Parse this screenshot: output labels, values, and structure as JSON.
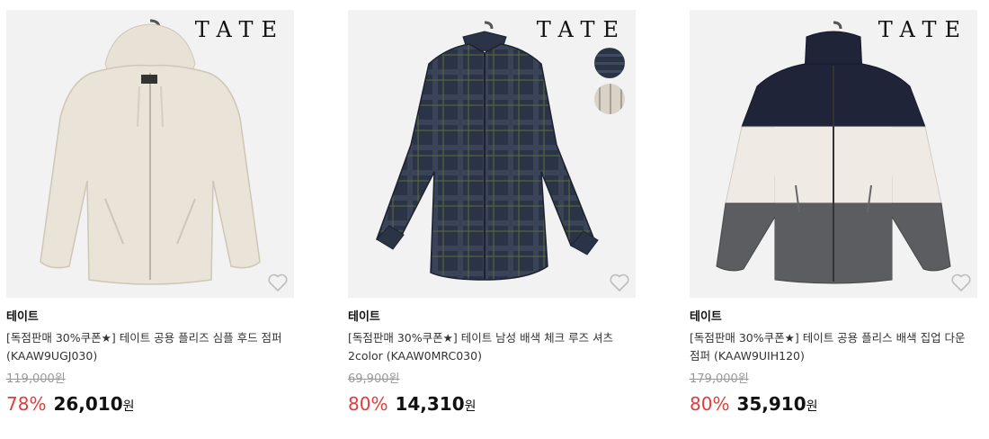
{
  "products": [
    {
      "logo": "TATE",
      "brand": "테이트",
      "title": "[독점판매 30%쿠폰★] 테이트 공용 플리즈 심플 후드 점퍼 (KAAW9UGJ030)",
      "original_price": "119,000원",
      "discount": "78%",
      "price": "26,010",
      "currency": "원"
    },
    {
      "logo": "TATE",
      "brand": "테이트",
      "title": "[독점판매 30%쿠폰★] 테이트 남성 배색 체크 루즈 셔츠 2color (KAAW0MRC030)",
      "original_price": "69,900원",
      "discount": "80%",
      "price": "14,310",
      "currency": "원"
    },
    {
      "logo": "TATE",
      "brand": "테이트",
      "title": "[독점판매 30%쿠폰★] 테이트 공용 플리스 배색 집업 다운 점퍼 (KAAW9UIH120)",
      "original_price": "179,000원",
      "discount": "80%",
      "price": "35,910",
      "currency": "원"
    }
  ],
  "colors": {
    "discount": "#e23c3c",
    "thumb_bg": "#f2f2f2",
    "heart": "#bdbdbd"
  },
  "icons": {
    "wishlist": "heart-outline-icon"
  }
}
